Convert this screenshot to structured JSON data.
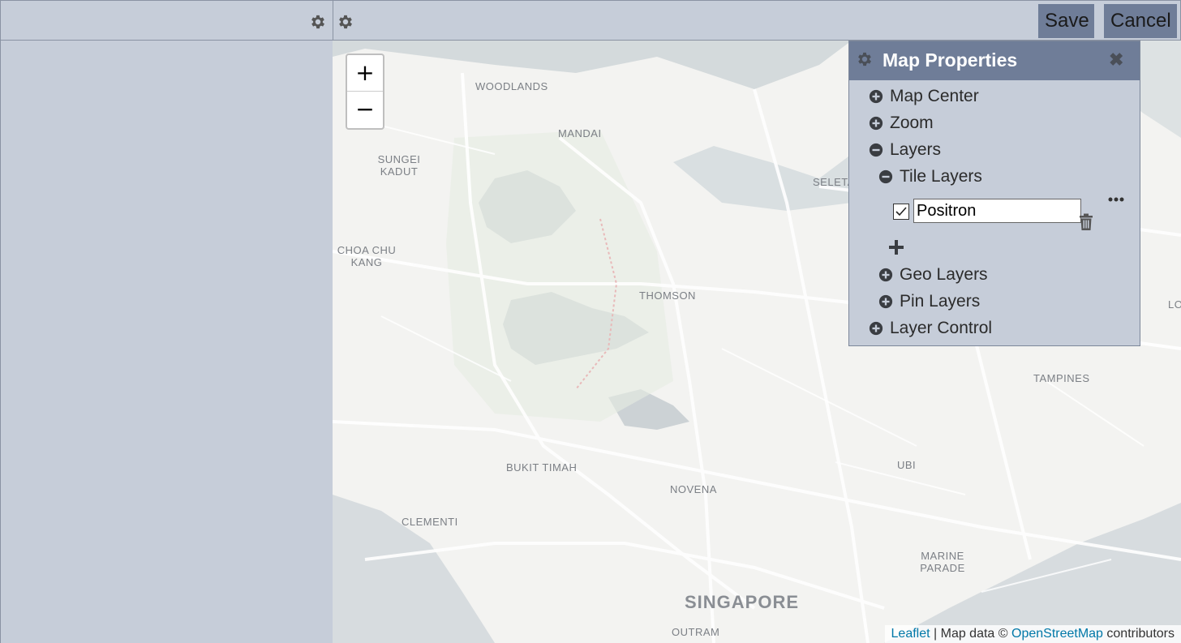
{
  "toolbar": {
    "save_label": "Save",
    "cancel_label": "Cancel"
  },
  "map": {
    "labels": {
      "woodlands": "WOODLANDS",
      "mandai": "MANDAI",
      "sungei_kadut": "SUNGEI KADUT",
      "seletar": "SELETA",
      "choa_chu_kang": "CHOA CHU KANG",
      "thomson": "THOMSON",
      "tampines": "TAMPINES",
      "bukit_timah": "BUKIT TIMAH",
      "novena": "NOVENA",
      "ubi": "UBI",
      "clementi": "CLEMENTI",
      "marine_parade": "MARINE PARADE",
      "singapore": "SINGAPORE",
      "outram": "OUTRAM",
      "edge_lo": "LO"
    },
    "zoom_in": "+",
    "zoom_out": "−",
    "attribution": {
      "leaflet": "Leaflet",
      "map_data": " | Map data © ",
      "osm": "OpenStreetMap",
      "contributors": " contributors"
    }
  },
  "properties": {
    "title": "Map Properties",
    "close": "✖",
    "items": {
      "map_center": "Map Center",
      "zoom": "Zoom",
      "layers": "Layers",
      "tile_layers": "Tile Layers",
      "geo_layers": "Geo Layers",
      "pin_layers": "Pin Layers",
      "layer_control": "Layer Control"
    },
    "tile_layer": {
      "value": "Positron",
      "checked": true
    }
  },
  "colors": {
    "panel": "#c6cdd9",
    "accent": "#6f7d98",
    "map_bg": "#f3f3f1",
    "water": "#d4dadc",
    "link": "#0078a8"
  }
}
